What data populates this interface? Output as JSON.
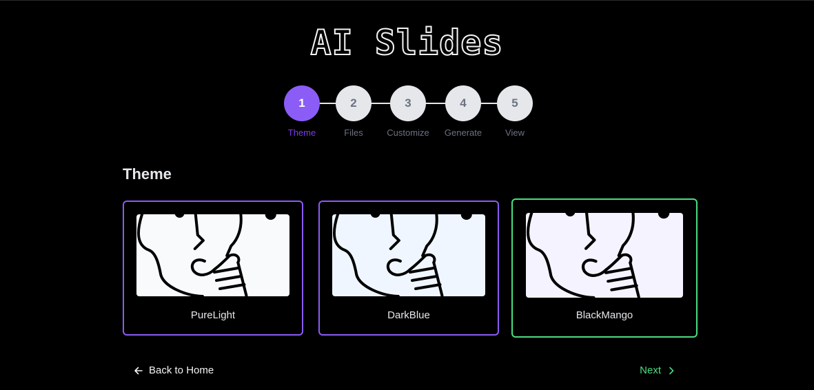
{
  "app_title": "AI Slides",
  "steps": [
    {
      "number": "1",
      "label": "Theme",
      "active": true
    },
    {
      "number": "2",
      "label": "Files",
      "active": false
    },
    {
      "number": "3",
      "label": "Customize",
      "active": false
    },
    {
      "number": "4",
      "label": "Generate",
      "active": false
    },
    {
      "number": "5",
      "label": "View",
      "active": false
    }
  ],
  "section": {
    "title": "Theme"
  },
  "themes": [
    {
      "name": "PureLight",
      "preview_bg": "#f8fafc",
      "selected": false
    },
    {
      "name": "DarkBlue",
      "preview_bg": "#eff6ff",
      "selected": false
    },
    {
      "name": "BlackMango",
      "preview_bg": "#f5f3ff",
      "selected": true
    }
  ],
  "footer": {
    "back_label": "Back to Home",
    "back_icon": "arrow-left-icon",
    "next_label": "Next",
    "next_icon": "chevron-right-icon"
  },
  "colors": {
    "accent": "#8b5cf6",
    "selected": "#4ade80",
    "background": "#000000"
  }
}
